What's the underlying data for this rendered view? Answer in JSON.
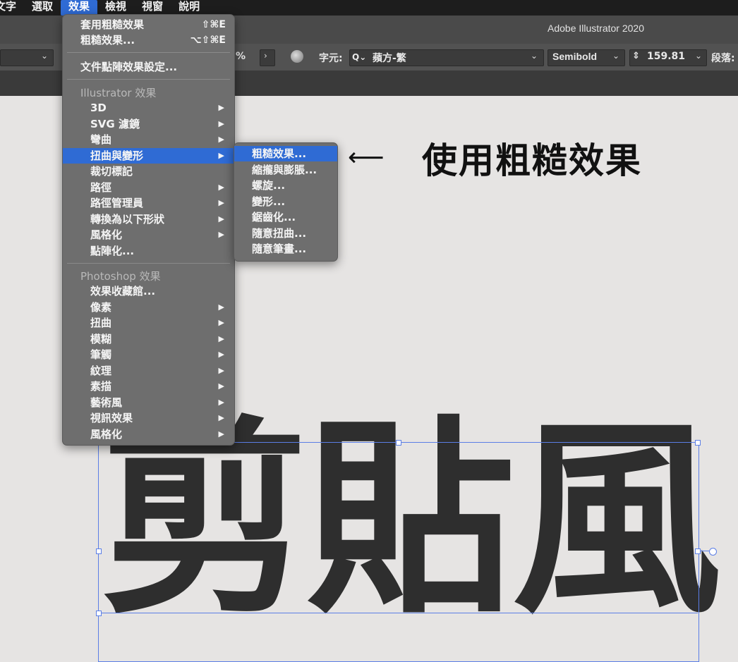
{
  "menubar": {
    "items": [
      "文字",
      "選取",
      "效果",
      "檢視",
      "視窗",
      "說明"
    ],
    "active_index": 2
  },
  "titlebar": {
    "title": "Adobe Illustrator 2020"
  },
  "controlbar": {
    "percent_suffix": "%",
    "char_label": "字元:",
    "font_name": "蘋方-繁",
    "font_style": "Semibold",
    "font_size": "159.81",
    "para_label": "段落:"
  },
  "effect_menu": {
    "apply_last": {
      "label": "套用粗糙效果",
      "shortcut": "⇧⌘E"
    },
    "last_effect": {
      "label": "粗糙效果...",
      "shortcut": "⌥⇧⌘E"
    },
    "doc_raster_settings": "文件點陣效果設定...",
    "illustrator_heading": "Illustrator 效果",
    "illustrator_items": [
      {
        "label": "3D",
        "submenu": true
      },
      {
        "label": "SVG 濾鏡",
        "submenu": true
      },
      {
        "label": "彎曲",
        "submenu": true
      },
      {
        "label": "扭曲與變形",
        "submenu": true,
        "highlighted": true
      },
      {
        "label": "裁切標記",
        "submenu": false
      },
      {
        "label": "路徑",
        "submenu": true
      },
      {
        "label": "路徑管理員",
        "submenu": true
      },
      {
        "label": "轉換為以下形狀",
        "submenu": true
      },
      {
        "label": "風格化",
        "submenu": true
      },
      {
        "label": "點陣化...",
        "submenu": false
      }
    ],
    "photoshop_heading": "Photoshop 效果",
    "photoshop_items": [
      {
        "label": "效果收藏館...",
        "submenu": false
      },
      {
        "label": "像素",
        "submenu": true
      },
      {
        "label": "扭曲",
        "submenu": true
      },
      {
        "label": "模糊",
        "submenu": true
      },
      {
        "label": "筆觸",
        "submenu": true
      },
      {
        "label": "紋理",
        "submenu": true
      },
      {
        "label": "素描",
        "submenu": true
      },
      {
        "label": "藝術風",
        "submenu": true
      },
      {
        "label": "視訊效果",
        "submenu": true
      },
      {
        "label": "風格化",
        "submenu": true
      }
    ]
  },
  "distort_submenu": {
    "items": [
      {
        "label": "粗糙效果...",
        "highlighted": true
      },
      {
        "label": "縮攏與膨脹..."
      },
      {
        "label": "螺旋..."
      },
      {
        "label": "變形..."
      },
      {
        "label": "鋸齒化..."
      },
      {
        "label": "隨意扭曲..."
      },
      {
        "label": "隨意筆畫..."
      }
    ]
  },
  "annotation": {
    "arrow": "⟵",
    "text": "使用粗糙效果"
  },
  "artwork": {
    "text": "剪貼風"
  },
  "colors": {
    "highlight": "#2f6bd4",
    "menu_bg": "#6e6e6e",
    "selection": "#5b7ee6"
  }
}
